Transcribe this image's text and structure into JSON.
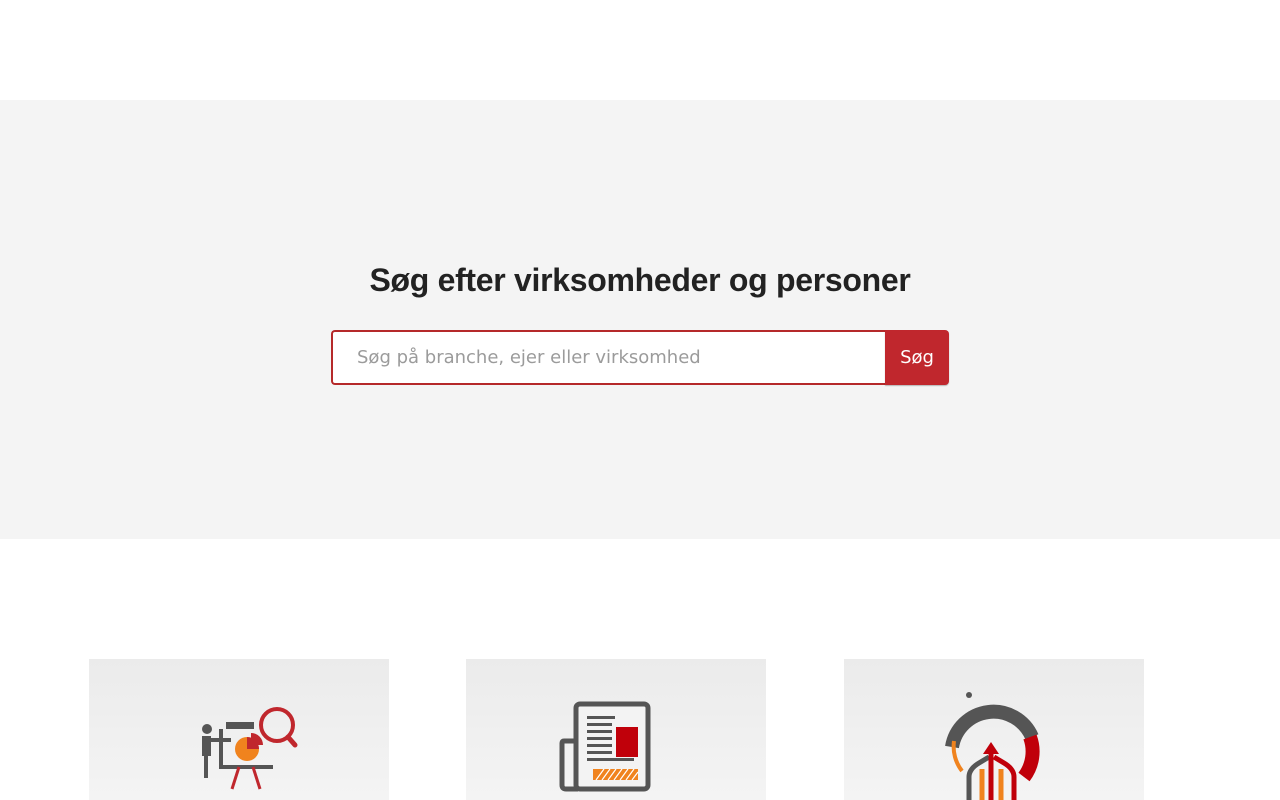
{
  "hero": {
    "title": "Søg efter virksomheder og personer"
  },
  "search": {
    "placeholder": "Søg på branche, ejer eller virksomhed",
    "value": "",
    "button_label": "Søg"
  },
  "cards": [
    {
      "icon": "presentation-analysis-icon"
    },
    {
      "icon": "newspaper-icon"
    },
    {
      "icon": "growth-arrows-gauge-icon"
    }
  ],
  "colors": {
    "accent": "#c0272d",
    "accent_border": "#b5292a",
    "hero_background": "#f4f4f4",
    "icon_gray": "#555555",
    "icon_orange": "#f0831e"
  }
}
